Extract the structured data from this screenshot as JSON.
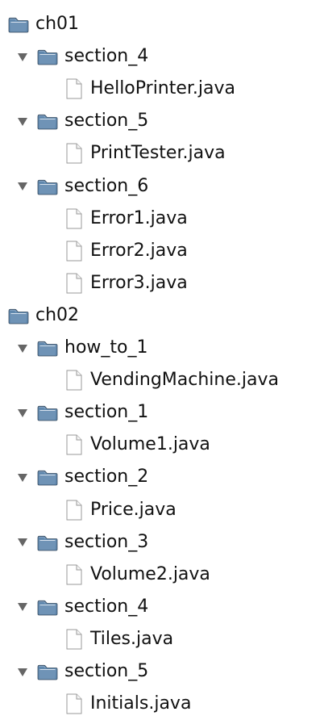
{
  "tree": [
    {
      "type": "folder",
      "level": 0,
      "label": "ch01",
      "icon": "folder-open-icon",
      "expanded": true
    },
    {
      "type": "folder",
      "level": 1,
      "label": "section_4",
      "icon": "folder-open-icon",
      "expanded": true
    },
    {
      "type": "file",
      "level": 2,
      "label": "HelloPrinter.java",
      "icon": "file-icon"
    },
    {
      "type": "folder",
      "level": 1,
      "label": "section_5",
      "icon": "folder-open-icon",
      "expanded": true
    },
    {
      "type": "file",
      "level": 2,
      "label": "PrintTester.java",
      "icon": "file-icon"
    },
    {
      "type": "folder",
      "level": 1,
      "label": "section_6",
      "icon": "folder-open-icon",
      "expanded": true
    },
    {
      "type": "file",
      "level": 2,
      "label": "Error1.java",
      "icon": "file-icon"
    },
    {
      "type": "file",
      "level": 2,
      "label": "Error2.java",
      "icon": "file-icon"
    },
    {
      "type": "file",
      "level": 2,
      "label": "Error3.java",
      "icon": "file-icon"
    },
    {
      "type": "folder",
      "level": 0,
      "label": "ch02",
      "icon": "folder-open-icon",
      "expanded": true
    },
    {
      "type": "folder",
      "level": 1,
      "label": "how_to_1",
      "icon": "folder-open-icon",
      "expanded": true
    },
    {
      "type": "file",
      "level": 2,
      "label": "VendingMachine.java",
      "icon": "file-icon"
    },
    {
      "type": "folder",
      "level": 1,
      "label": "section_1",
      "icon": "folder-open-icon",
      "expanded": true
    },
    {
      "type": "file",
      "level": 2,
      "label": "Volume1.java",
      "icon": "file-icon"
    },
    {
      "type": "folder",
      "level": 1,
      "label": "section_2",
      "icon": "folder-open-icon",
      "expanded": true
    },
    {
      "type": "file",
      "level": 2,
      "label": "Price.java",
      "icon": "file-icon"
    },
    {
      "type": "folder",
      "level": 1,
      "label": "section_3",
      "icon": "folder-open-icon",
      "expanded": true
    },
    {
      "type": "file",
      "level": 2,
      "label": "Volume2.java",
      "icon": "file-icon"
    },
    {
      "type": "folder",
      "level": 1,
      "label": "section_4",
      "icon": "folder-open-icon",
      "expanded": true
    },
    {
      "type": "file",
      "level": 2,
      "label": "Tiles.java",
      "icon": "file-icon"
    },
    {
      "type": "folder",
      "level": 1,
      "label": "section_5",
      "icon": "folder-open-icon",
      "expanded": true
    },
    {
      "type": "file",
      "level": 2,
      "label": "Initials.java",
      "icon": "file-icon"
    }
  ],
  "colors": {
    "folder_body": "#5f87ad",
    "folder_tab": "#3f678f",
    "folder_highlight": "#d7e2ee",
    "twisty": "#666666",
    "file_outline": "#9a9a9a",
    "text": "#111111"
  }
}
